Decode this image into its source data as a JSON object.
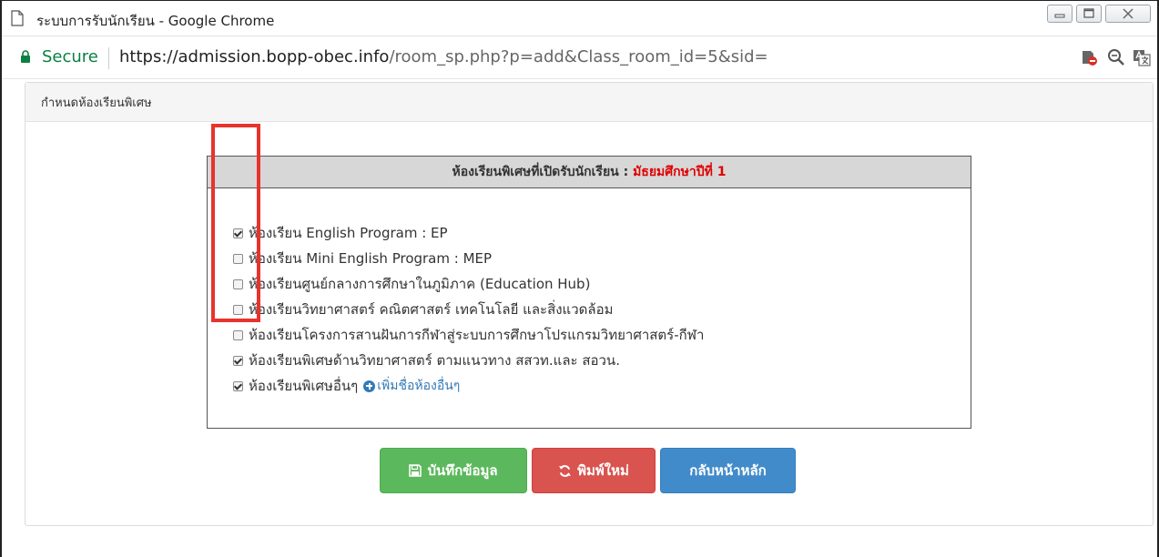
{
  "window": {
    "title": "ระบบการรับนักเรียน - Google Chrome"
  },
  "addressbar": {
    "secure_label": "Secure",
    "url_scheme": "https://",
    "url_host": "admission.bopp-obec.info",
    "url_path": "/room_sp.php?p=add&Class_room_id=5&sid="
  },
  "panel": {
    "title": "กำหนดห้องเรียนพิเศษ"
  },
  "box": {
    "heading": "ห้องเรียนพิเศษที่เปิดรับนักเรียน : ",
    "level": "มัธยมศึกษาปีที่ 1",
    "options": [
      {
        "label": "ห้องเรียน English Program : EP",
        "checked": true
      },
      {
        "label": "ห้องเรียน Mini English Program : MEP",
        "checked": false
      },
      {
        "label": "ห้องเรียนศูนย์กลางการศึกษาในภูมิภาค (Education Hub)",
        "checked": false
      },
      {
        "label": "ห้องเรียนวิทยาศาสตร์ คณิตศาสตร์ เทคโนโลยี และสิ่งแวดล้อม",
        "checked": false
      },
      {
        "label": "ห้องเรียนโครงการสานฝันการกีฬาสู่ระบบการศึกษาโปรแกรมวิทยาศาสตร์-กีฬา",
        "checked": false
      },
      {
        "label": "ห้องเรียนพิเศษด้านวิทยาศาสตร์ ตามแนวทาง สสวท.และ สอวน.",
        "checked": true
      },
      {
        "label": "ห้องเรียนพิเศษอื่นๆ",
        "checked": true
      }
    ],
    "add_link": "เพิ่มชื่อห้องอื่นๆ"
  },
  "buttons": {
    "save": "บันทึกข้อมูล",
    "reset": "พิมพ์ใหม่",
    "home": "กลับหน้าหลัก"
  },
  "colors": {
    "secure": "#0b8043",
    "level_text": "#e00000",
    "save": "#5cb85c",
    "reset": "#d9534f",
    "home": "#428bca",
    "highlight": "#e8332d"
  }
}
